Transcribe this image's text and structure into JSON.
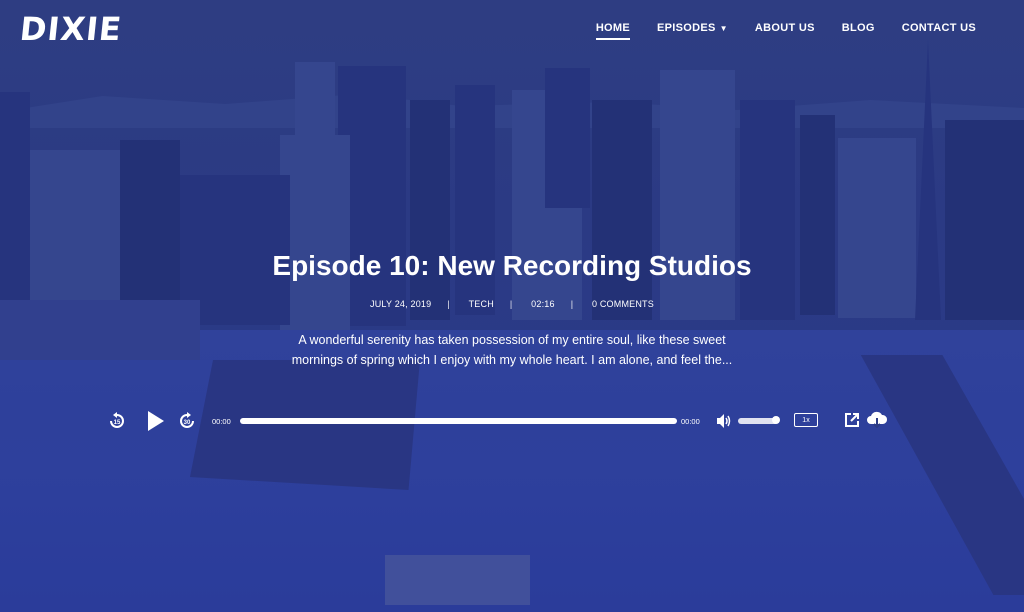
{
  "header": {
    "logo": "DIXIE",
    "nav": [
      {
        "label": "HOME",
        "active": true
      },
      {
        "label": "EPISODES",
        "has_dropdown": true
      },
      {
        "label": "ABOUT US"
      },
      {
        "label": "BLOG"
      },
      {
        "label": "CONTACT US"
      }
    ]
  },
  "episode": {
    "title": "Episode 10: New Recording Studios",
    "meta": {
      "date": "JULY 24, 2019",
      "category": "TECH",
      "duration": "02:16",
      "comments": "0 COMMENTS"
    },
    "excerpt": "A wonderful serenity has taken possession of my entire soul, like these sweet mornings of spring which I enjoy with my whole heart. I am alone, and feel the..."
  },
  "player": {
    "current_time": "00:00",
    "total_time": "00:00",
    "speed": "1x",
    "icons": [
      "rewind-icon",
      "play-icon",
      "forward-icon",
      "volume-icon",
      "share-icon",
      "download-icon"
    ]
  },
  "colors": {
    "overlay": "#2b3b85",
    "text": "#ffffff"
  }
}
